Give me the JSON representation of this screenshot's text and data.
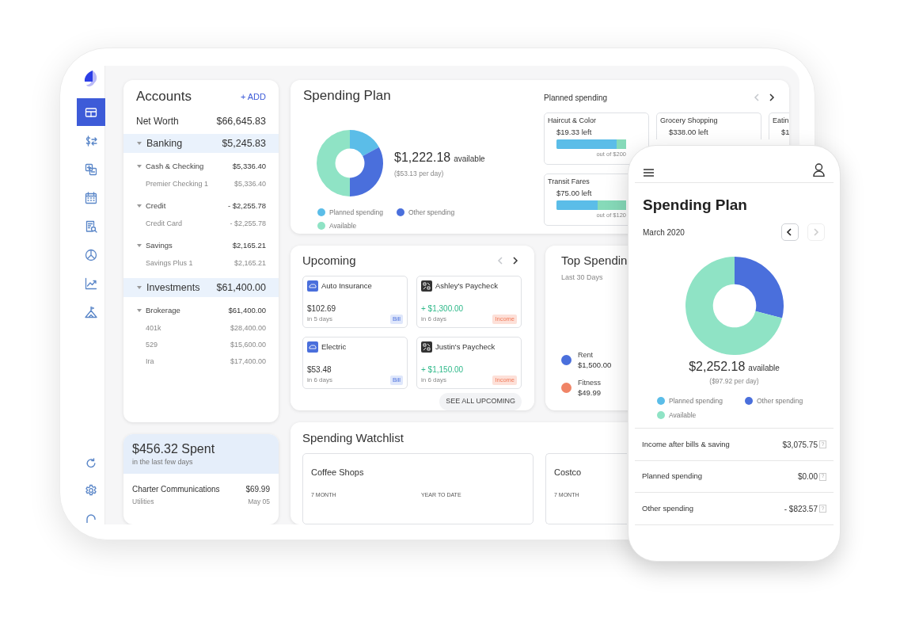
{
  "tablet": {
    "sidebar": {
      "items": [
        {
          "selected": true
        },
        {
          "selected": false
        },
        {
          "selected": false
        },
        {
          "selected": false
        },
        {
          "selected": false
        },
        {
          "selected": false
        },
        {
          "selected": false
        },
        {
          "selected": false
        }
      ]
    },
    "accounts": {
      "title": "Accounts",
      "add": "+ ADD",
      "net_worth": {
        "label": "Net Worth",
        "value": "$66,645.83"
      },
      "groups": [
        {
          "name": "Banking",
          "total": "$5,245.83",
          "expanded": true,
          "children": [
            {
              "name": "Cash & Checking",
              "total": "$5,336.40",
              "expanded": true,
              "children": [
                {
                  "name": "Premier Checking 1",
                  "total": "$5,336.40"
                }
              ]
            },
            {
              "name": "Credit",
              "total": "- $2,255.78",
              "expanded": true,
              "children": [
                {
                  "name": "Credit Card",
                  "total": "- $2,255.78"
                }
              ]
            },
            {
              "name": "Savings",
              "total": "$2,165.21",
              "expanded": true,
              "children": [
                {
                  "name": "Savings Plus 1",
                  "total": "$2,165.21"
                }
              ]
            }
          ]
        },
        {
          "name": "Investments",
          "total": "$61,400.00",
          "expanded": true,
          "children": [
            {
              "name": "Brokerage",
              "total": "$61,400.00",
              "expanded": true,
              "children": [
                {
                  "name": "401k",
                  "total": "$28,400.00"
                },
                {
                  "name": "529",
                  "total": "$15,600.00"
                },
                {
                  "name": "Ira",
                  "total": "$17,400.00"
                }
              ]
            }
          ]
        }
      ]
    },
    "spent": {
      "title": "$456.32 Spent",
      "subtitle": "in the last few days",
      "items": [
        {
          "payee": "Charter Communications",
          "amount": "$69.99",
          "category": "Utilities",
          "date": "May 05"
        }
      ]
    },
    "spending_plan": {
      "title": "Spending Plan",
      "available": "$1,222.18",
      "available_label": "available",
      "per_day": "($53.13 per day)",
      "legend": [
        {
          "label": "Planned spending",
          "color": "#5bbde8"
        },
        {
          "label": "Other spending",
          "color": "#4a6fdc"
        },
        {
          "label": "Available",
          "color": "#8fe3c5"
        }
      ],
      "planned": {
        "title": "Planned spending",
        "pager": {
          "previous": {
            "disabled": true
          },
          "next": {
            "disabled": false
          }
        },
        "cards": [
          {
            "title": "Haircut & Color",
            "left": "$19.33 left",
            "level": 0.86,
            "out_of": "out of $200"
          },
          {
            "title": "Grocery Shopping",
            "left": "$338.00 left"
          },
          {
            "title": "Eatin",
            "left": "$1"
          },
          {
            "title": "Transit Fares",
            "left": "$75.00 left",
            "level": 0.59,
            "out_of": "out of $120"
          }
        ]
      }
    },
    "upcoming": {
      "title": "Upcoming",
      "pager": {
        "previous": {
          "disabled": true
        },
        "next": {
          "disabled": false
        }
      },
      "items": [
        {
          "kind": "bill",
          "name": "Auto Insurance",
          "amount": "$102.69",
          "due": "in 5 days",
          "badge": "Bill"
        },
        {
          "kind": "income",
          "name": "Ashley's Paycheck",
          "amount": "+ $1,300.00",
          "due": "in 6 days",
          "badge": "Income"
        },
        {
          "kind": "bill",
          "name": "Electric",
          "amount": "$53.48",
          "due": "in 6 days",
          "badge": "Bill"
        },
        {
          "kind": "income",
          "name": "Justin's Paycheck",
          "amount": "+ $1,150.00",
          "due": "in 6 days",
          "badge": "Income"
        }
      ],
      "see_all": "SEE ALL UPCOMING"
    },
    "top_spending": {
      "title": "Top Spendin",
      "subtitle": "Last 30 Days",
      "legend": [
        {
          "label": "Rent",
          "amount": "$1,500.00",
          "color": "#4a6fdc"
        },
        {
          "label": "Fitness",
          "amount": "$49.99",
          "color": "#f08466"
        }
      ]
    },
    "watchlist": {
      "title": "Spending Watchlist",
      "cards": [
        {
          "title": "Coffee Shops",
          "columns": [
            "7 MONTH",
            "YEAR TO DATE"
          ]
        },
        {
          "title": "Costco",
          "columns": [
            "7 MONTH"
          ]
        }
      ]
    }
  },
  "phone": {
    "title": "Spending Plan",
    "month": "March 2020",
    "month_nav": {
      "previous": {
        "disabled": false
      },
      "next": {
        "disabled": true
      }
    },
    "available": "$2,252.18",
    "available_label": "available",
    "per_day": "($97.92 per day)",
    "legend": [
      {
        "label": "Planned spending",
        "color": "#5bbde8"
      },
      {
        "label": "Other spending",
        "color": "#4a6fdc"
      },
      {
        "label": "Available",
        "color": "#8fe3c5"
      }
    ],
    "summary": [
      {
        "label": "Income after bills & saving",
        "value": "$3,075.75",
        "help": "?"
      },
      {
        "label": "Planned spending",
        "value": "$0.00",
        "help": "?"
      },
      {
        "label": "Other spending",
        "value": "- $823.57",
        "help": "?"
      }
    ]
  }
}
